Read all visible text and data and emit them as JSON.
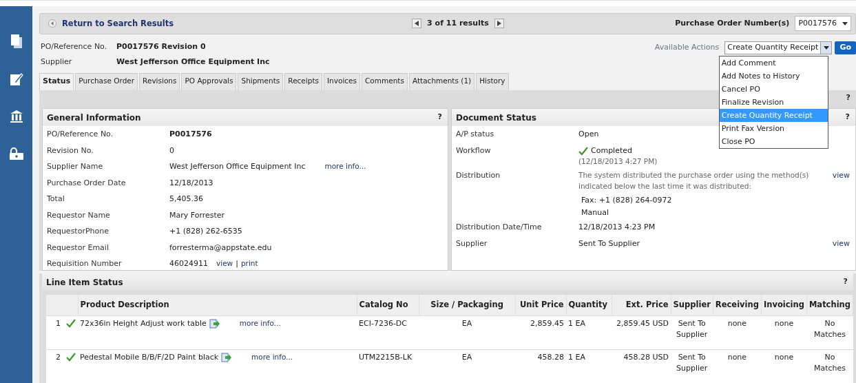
{
  "nav_bar": {
    "back_link": "Return to Search Results",
    "pager": "3 of 11 results",
    "po_number_label": "Purchase Order Number(s)",
    "po_number_value": "P0017576"
  },
  "header": [
    {
      "label": "PO/Reference No.",
      "value": "P0017576 Revision 0"
    },
    {
      "label": "Supplier",
      "value": "West Jefferson Office Equipment Inc"
    }
  ],
  "actions": {
    "label": "Available Actions",
    "value": "Create Quantity Receipt",
    "button": "Go",
    "expanded": true,
    "options": [
      {
        "label": "Add Comment",
        "selected": false
      },
      {
        "label": "Add Notes to History",
        "selected": false
      },
      {
        "label": "Cancel PO",
        "selected": false
      },
      {
        "label": "Finalize Revision",
        "selected": false
      },
      {
        "label": "Create Quantity Receipt",
        "selected": true
      },
      {
        "label": "Print Fax Version",
        "selected": false
      },
      {
        "label": "Close PO",
        "selected": false
      }
    ]
  },
  "tabs": [
    {
      "label": "Status",
      "selected": true
    },
    {
      "label": "Purchase Order",
      "selected": false
    },
    {
      "label": "Revisions",
      "selected": false
    },
    {
      "label": "PO Approvals",
      "selected": false
    },
    {
      "label": "Shipments",
      "selected": false
    },
    {
      "label": "Receipts",
      "selected": false
    },
    {
      "label": "Invoices",
      "selected": false
    },
    {
      "label": "Comments",
      "selected": false
    },
    {
      "label": "Attachments (1)",
      "selected": false
    },
    {
      "label": "History",
      "selected": false
    }
  ],
  "toolbar": {
    "help": "?"
  },
  "general_information": {
    "title": "General Information",
    "help": "?",
    "rows": [
      {
        "label": "PO/Reference No.",
        "value": "P0017576",
        "strong": true
      },
      {
        "label": "Revision No.",
        "value": "0",
        "strong": false
      },
      {
        "label": "Supplier Name",
        "value": "West Jefferson Office Equipment Inc",
        "strong": false,
        "links": [
          "more info..."
        ]
      },
      {
        "label": "Purchase Order Date",
        "value": "12/18/2013",
        "strong": false
      },
      {
        "label": "Total",
        "value": "5,405.36",
        "strong": false
      },
      {
        "label": "Requestor Name",
        "value": "Mary Forrester",
        "strong": false
      },
      {
        "label": "RequestorPhone",
        "value": "+1 (828) 262-6535",
        "strong": false
      },
      {
        "label": "Requestor Email",
        "value": "forresterma@appstate.edu",
        "strong": false
      },
      {
        "label": "Requisition Number",
        "value": "46024911",
        "strong": false,
        "links": [
          "view",
          "print"
        ],
        "separator": "|"
      }
    ]
  },
  "document_status": {
    "title": "Document Status",
    "help": "?",
    "rows": [
      {
        "kind": "text",
        "label": "A/P status",
        "value": "Open"
      },
      {
        "kind": "workflow",
        "label": "Workflow",
        "value": "Completed",
        "note": "(12/18/2013 4:27 PM)"
      },
      {
        "kind": "distribution",
        "label": "Distribution",
        "note": "The system distributed the purchase order using the method(s) indicated below the last time it was distributed:",
        "link": "view",
        "methods": [
          "Fax: +1 (828) 264-0972",
          "Manual"
        ]
      },
      {
        "kind": "text",
        "label": "Distribution Date/Time",
        "value": "12/18/2013 4:23 PM"
      },
      {
        "kind": "text",
        "label": "Supplier",
        "value": "Sent To Supplier",
        "link": "view"
      }
    ]
  },
  "line_item_status": {
    "title": "Line Item Status",
    "help": "?",
    "columns": [
      "Product Description",
      "Catalog No",
      "Size / Packaging",
      "Unit Price",
      "Quantity",
      "Ext. Price",
      "Supplier",
      "Receiving",
      "Invoicing",
      "Matching"
    ],
    "rows": [
      {
        "number": "1",
        "complete": true,
        "description": "72x36in Height Adjust work table",
        "link": "more info...",
        "catalog_no": "ECI-7236-DC",
        "size": "EA",
        "unit_price": "2,859.45",
        "quantity": "1 EA",
        "ext_price": "2,859.45 USD",
        "supplier": "Sent To Supplier",
        "receiving": "none",
        "invoicing": "none",
        "matching": "No Matches"
      },
      {
        "number": "2",
        "complete": true,
        "description": "Pedestal Mobile B/B/F/2D Paint black",
        "link": "more info...",
        "catalog_no": "UTM2215B-LK",
        "size": "EA",
        "unit_price": "458.28",
        "quantity": "1 EA",
        "ext_price": "458.28 USD",
        "supplier": "Sent To Supplier",
        "receiving": "none",
        "invoicing": "none",
        "matching": "No Matches"
      }
    ]
  }
}
